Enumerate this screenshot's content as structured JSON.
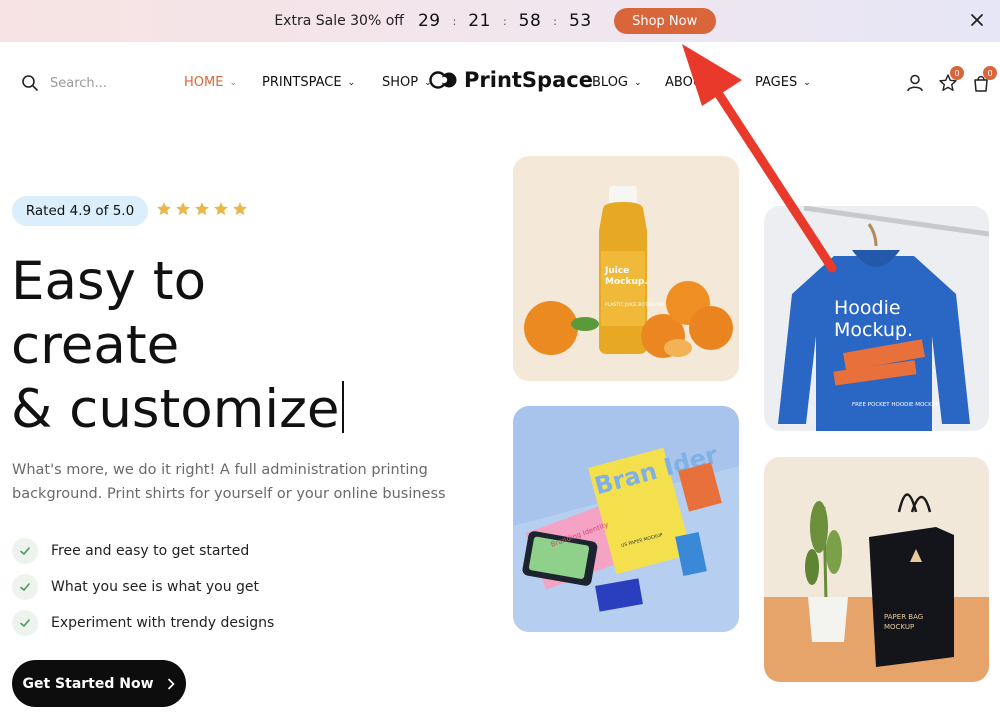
{
  "promo": {
    "text": "Extra Sale 30% off",
    "countdown": [
      "29",
      "21",
      "58",
      "53"
    ],
    "separator": ":",
    "button_label": "Shop Now",
    "close_icon": "close-icon"
  },
  "header": {
    "search_placeholder": "Search...",
    "nav_left": [
      {
        "label": "HOME",
        "active": true
      },
      {
        "label": "PRINTSPACE",
        "active": false
      },
      {
        "label": "SHOP",
        "active": false
      }
    ],
    "logo_text": "PrintSpace",
    "nav_right": [
      {
        "label": "BLOG"
      },
      {
        "label": "ABOUT"
      },
      {
        "label": "PAGES"
      }
    ],
    "wishlist_count": "0",
    "cart_count": "0",
    "caret": "⌄"
  },
  "hero": {
    "rating_label": "Rated 4.9 of 5.0",
    "star_count": 5,
    "headline_lines": [
      "Easy to",
      "create",
      "& customize"
    ],
    "description": "What's more, we do it right! A full administration printing background. Print shirts for yourself or your online business",
    "features": [
      "Free and easy to get started",
      "What you see is what you get",
      "Experiment with trendy designs"
    ],
    "cta_label": "Get Started Now"
  },
  "cards": {
    "juice": {
      "title_line1": "Juice",
      "title_line2": "Mockup.",
      "small_text": "PLASTIC JUICE BOTTLE MOCKUP"
    },
    "hoodie": {
      "title_line1": "Hoodie",
      "title_line2": "Mockup.",
      "small_text": "FREE POCKET HOODIE MOCKUP"
    },
    "branding": {
      "big_text": "Bran Ider",
      "side_text": "Branding Identity",
      "small_text": "US PAPER MOCKUP"
    },
    "bag": {
      "title_line1": "PAPER BAG",
      "title_line2": "MOCKUP"
    }
  },
  "colors": {
    "accent": "#d9663a",
    "dark": "#0d0d0d",
    "pill_bg": "#dbeefb",
    "star": "#e8b84a",
    "arrow": "#e8392a"
  }
}
